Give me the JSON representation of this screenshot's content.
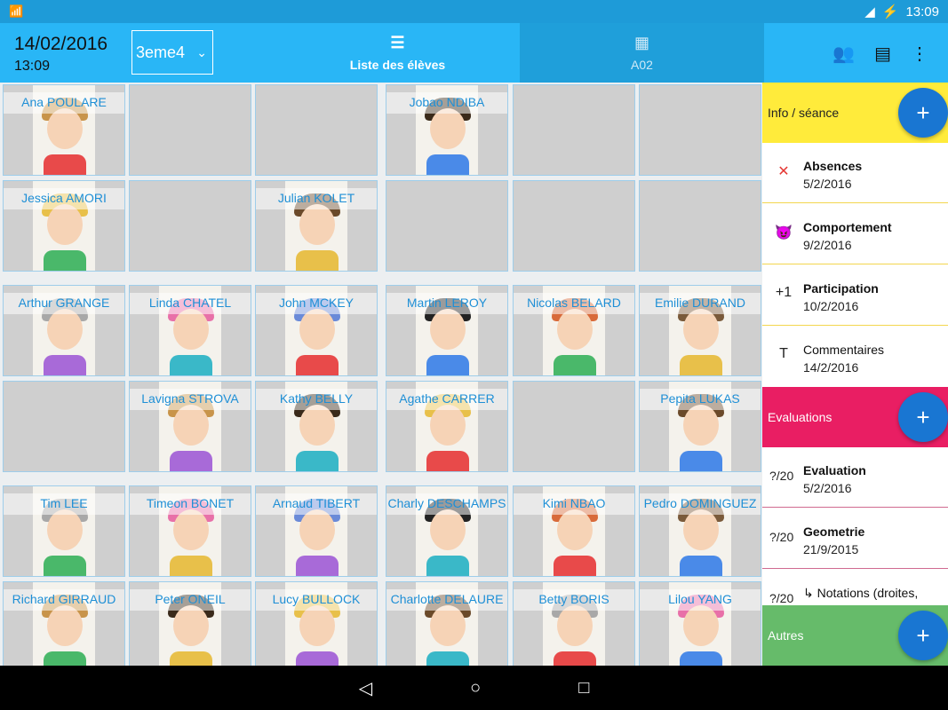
{
  "status": {
    "time": "13:09",
    "battery": "⚡"
  },
  "header": {
    "date": "14/02/2016",
    "time": "13:09",
    "class": "3eme4",
    "tabs": [
      {
        "label": "Liste des élèves"
      },
      {
        "label": "A02"
      }
    ]
  },
  "grid": {
    "rows": [
      [
        "Ana POULARE",
        "",
        "",
        "Jobao NDIBA",
        "",
        ""
      ],
      [
        "Jessica AMORI",
        "",
        "Julian KOLET",
        "",
        "",
        ""
      ],
      [
        "Arthur GRANGE",
        "Linda CHATEL",
        "John MCKEY",
        "Martin LEROY",
        "Nicolas BELARD",
        "Emilie DURAND"
      ],
      [
        "",
        "Lavigna STROVA",
        "Kathy BELLY",
        "Agathe CARRER",
        "",
        "Pepita LUKAS"
      ],
      [
        "Tim LEE",
        "Timeon BONET",
        "Arnaud TIBERT",
        "Charly DESCHAMPS",
        "Kimi NBAO",
        "Pedro DOMINGUEZ"
      ],
      [
        "Richard GIRRAUD",
        "Peter ONEIL",
        "Lucy BULLOCK",
        "Charlotte DELAURE",
        "Betty BORIS",
        "Lilou YANG"
      ]
    ]
  },
  "side": {
    "info_title": "Info / séance",
    "info_items": [
      {
        "icon": "✕",
        "title": "Absences",
        "date": "5/2/2016",
        "bold": true
      },
      {
        "icon": "😈",
        "title": "Comportement",
        "date": "9/2/2016",
        "bold": true
      },
      {
        "icon": "+1",
        "title": "Participation",
        "date": "10/2/2016",
        "bold": true
      },
      {
        "icon": "T",
        "title": "Commentaires",
        "date": "14/2/2016",
        "bold": false
      }
    ],
    "eval_title": "Evaluations",
    "eval_items": [
      {
        "icon": "?/20",
        "title": "Evaluation",
        "date": "5/2/2016"
      },
      {
        "icon": "?/20",
        "title": "Geometrie",
        "date": "21/9/2015"
      },
      {
        "icon": "?/20",
        "title": "↳ Notations (droites,",
        "date": ""
      }
    ],
    "autres_title": "Autres",
    "fab_label": "+"
  },
  "colors": {
    "appbar": "#29b6f6",
    "info": "#ffeb3b",
    "eval": "#e91e63",
    "autres": "#66bb6a",
    "fab": "#1976d2",
    "name_text": "#1e8fd6"
  }
}
